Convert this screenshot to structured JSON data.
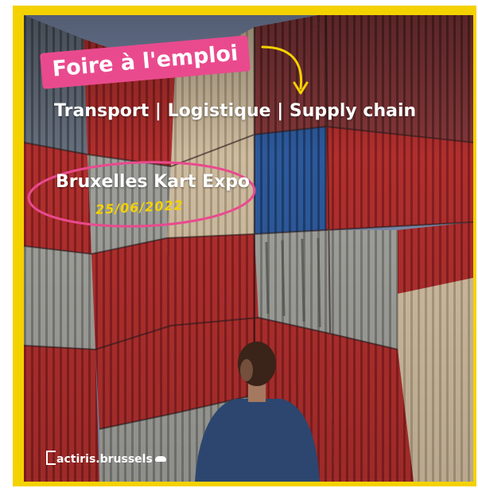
{
  "poster": {
    "title": "Foire à l'emploi",
    "subtitle": "Transport | Logistique | Supply chain",
    "venue": "Bruxelles Kart Expo",
    "date": "25/06/2022",
    "brand": "actiris.brussels"
  },
  "colors": {
    "frame": "#f4d200",
    "accent_pink": "#e94a8e",
    "date_yellow": "#f4d200",
    "text": "#ffffff"
  },
  "icons": [
    "curved-arrow-icon",
    "cloud-icon"
  ]
}
